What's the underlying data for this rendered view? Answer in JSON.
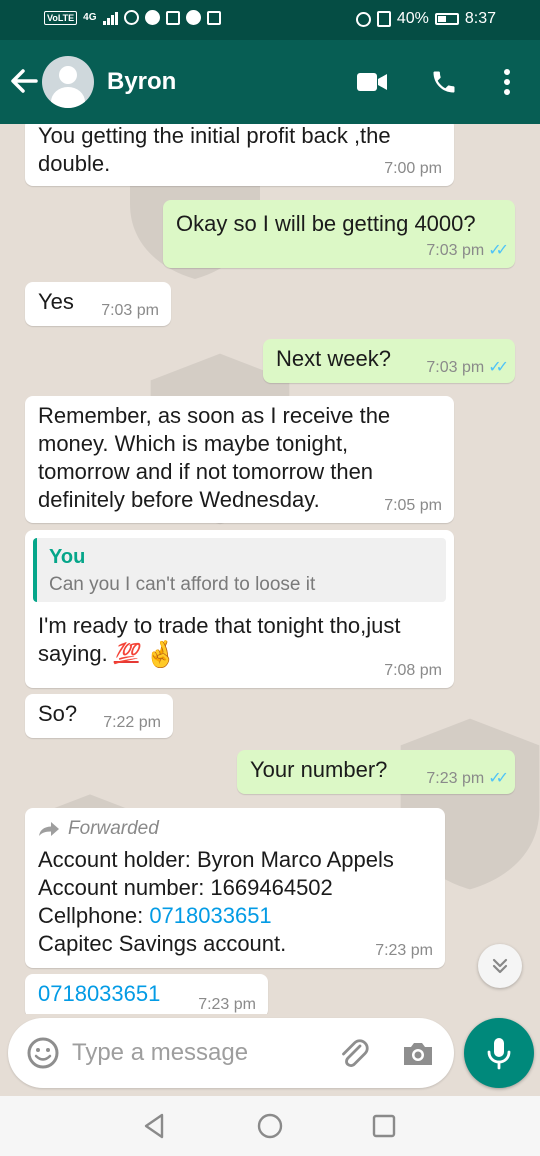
{
  "status_bar": {
    "network": "VoLTE",
    "network_type": "4G",
    "battery": "40%",
    "time": "8:37"
  },
  "header": {
    "contact_name": "Byron"
  },
  "messages": [
    {
      "text": "You getting the initial profit back ,the double.",
      "line1": "You getting the initial profit back ,the",
      "line2": "double.",
      "time": "7:00 pm"
    },
    {
      "text": "Okay so I will be getting 4000?",
      "time": "7:03 pm"
    },
    {
      "text": "Yes",
      "time": "7:03 pm"
    },
    {
      "text": "Next week?",
      "time": "7:03 pm"
    },
    {
      "lines": [
        "Remember, as soon as I receive the",
        "money. Which is maybe tonight,",
        "tomorrow and if not tomorrow then",
        "definitely before Wednesday."
      ],
      "time": "7:05 pm"
    },
    {
      "quote_author": "You",
      "quote_text": "Can you I can't afford to loose it",
      "line1": "I'm ready to trade that tonight tho,just",
      "line2": "saying.",
      "emoji1": "💯",
      "emoji2": "🤞",
      "time": "7:08 pm"
    },
    {
      "text": "So?",
      "time": "7:22 pm"
    },
    {
      "text": "Your number?",
      "time": "7:23 pm"
    },
    {
      "forwarded_label": "Forwarded",
      "line1": "Account holder: Byron Marco Appels",
      "line2": "Account number: 1669464502",
      "line3_label": "Cellphone: ",
      "line3_link": "0718033651",
      "line4": "Capitec Savings account.",
      "time": "7:23 pm"
    },
    {
      "link": "0718033651",
      "time": "7:23 pm"
    }
  ],
  "composer": {
    "placeholder": "Type a message"
  },
  "colors": {
    "app_bar": "#075e54",
    "status_bar": "#054d44",
    "outgoing_bubble": "#dcf8c6",
    "incoming_bubble": "#ffffff",
    "link": "#039be5",
    "read_ticks": "#4fc3f7",
    "accent": "#00897b"
  },
  "icons": [
    "back-arrow-icon",
    "video-call-icon",
    "phone-icon",
    "more-vert-icon",
    "double-check-icon",
    "forward-icon",
    "chevron-down-icon",
    "emoji-icon",
    "attach-icon",
    "camera-icon",
    "mic-icon",
    "nav-back-icon",
    "nav-home-icon",
    "nav-recents-icon"
  ]
}
